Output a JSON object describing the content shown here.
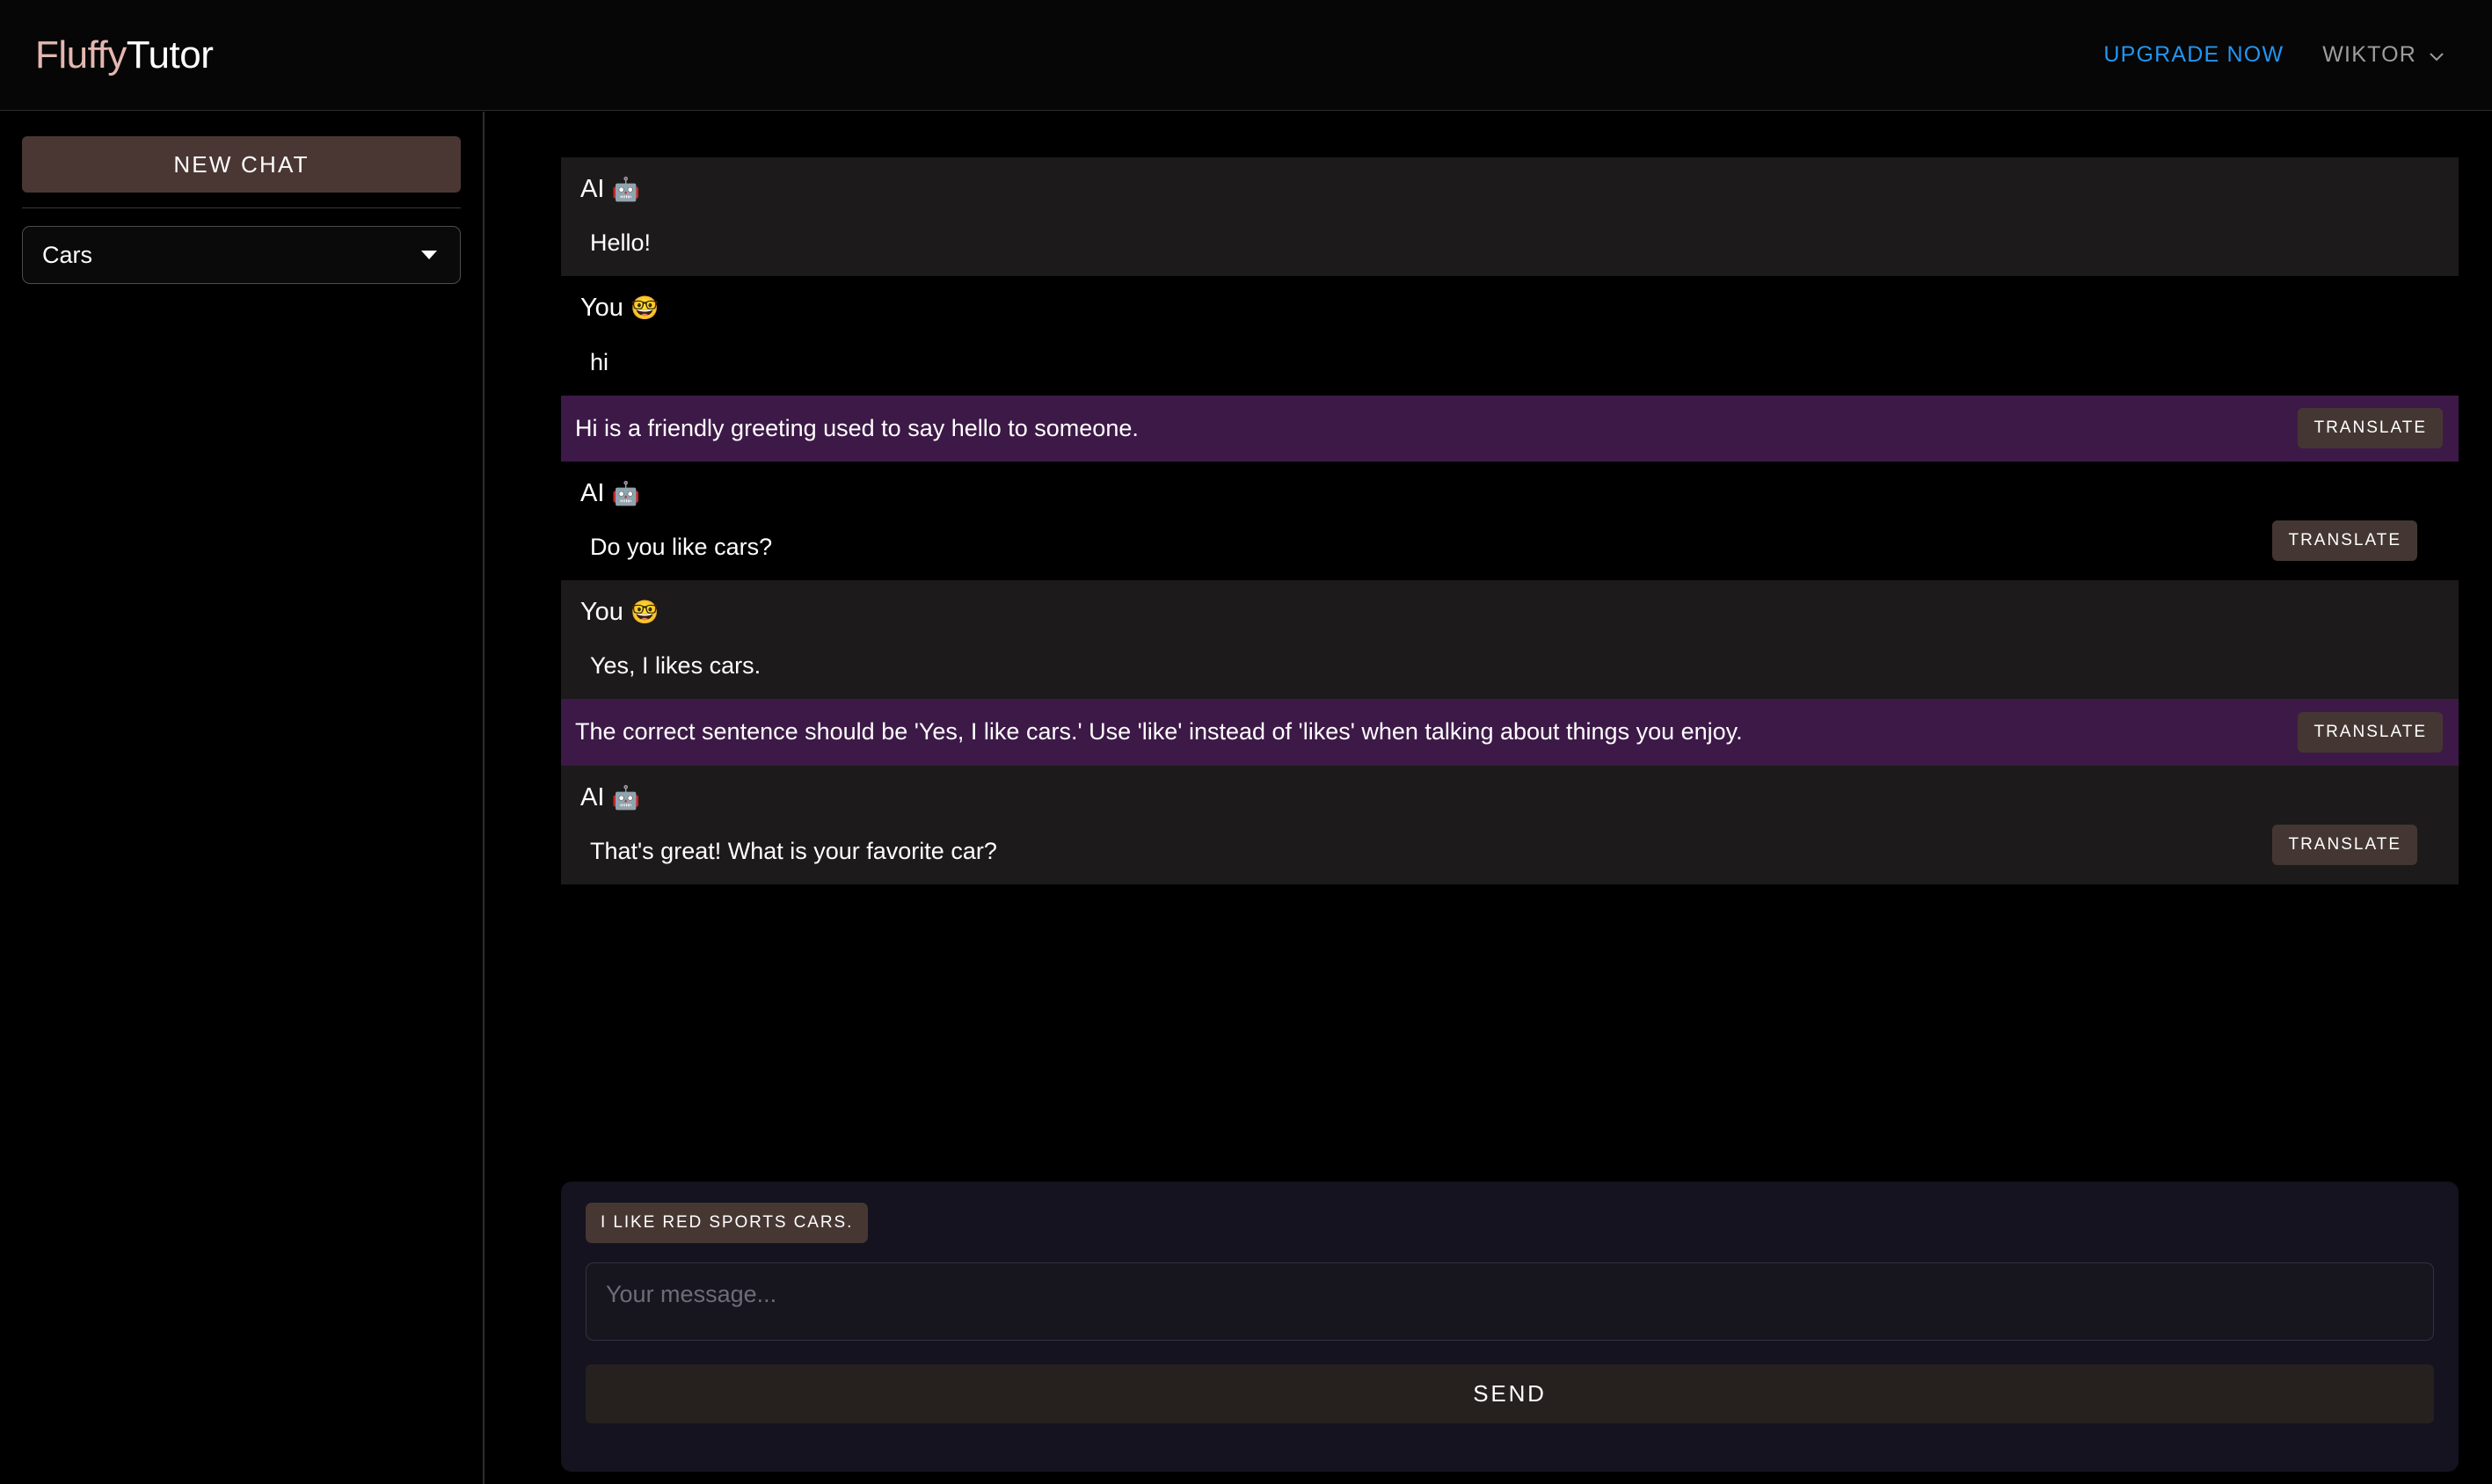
{
  "header": {
    "logo_primary": "Fluffy",
    "logo_secondary": "Tutor",
    "upgrade_label": "UPGRADE NOW",
    "user_label": "WIKTOR",
    "chevron_icon": "chevron-down-icon",
    "accent_upgrade_color": "#2196f3",
    "logo_accent_color": "#e3b7b0"
  },
  "sidebar": {
    "new_chat_label": "NEW CHAT",
    "topic_value": "Cars",
    "topic_caret_icon": "caret-down-icon"
  },
  "chat": {
    "translate_label": "TRANSLATE",
    "messages": [
      {
        "author": "AI",
        "emoji": "🤖",
        "text": "Hello!",
        "style": "shade",
        "has_translate": false
      },
      {
        "author": "You",
        "emoji": "🤓",
        "text": "hi",
        "style": "plain",
        "has_translate": false
      },
      {
        "type": "feedback",
        "text": "Hi is a friendly greeting used to say hello to someone.",
        "has_translate": true
      },
      {
        "author": "AI",
        "emoji": "🤖",
        "text": "Do you like cars?",
        "style": "plain",
        "has_translate": true
      },
      {
        "author": "You",
        "emoji": "🤓",
        "text": "Yes, I likes cars.",
        "style": "shade",
        "has_translate": false
      },
      {
        "type": "feedback",
        "text": "The correct sentence should be 'Yes, I like cars.' Use 'like' instead of 'likes' when talking about things you enjoy.",
        "has_translate": true
      },
      {
        "author": "AI",
        "emoji": "🤖",
        "text": "That's great! What is your favorite car?",
        "style": "shade",
        "has_translate": true
      }
    ]
  },
  "composer": {
    "suggestion_chip": "I LIKE RED SPORTS CARS.",
    "input_value": "",
    "input_placeholder": "Your message...",
    "send_label": "SEND"
  }
}
